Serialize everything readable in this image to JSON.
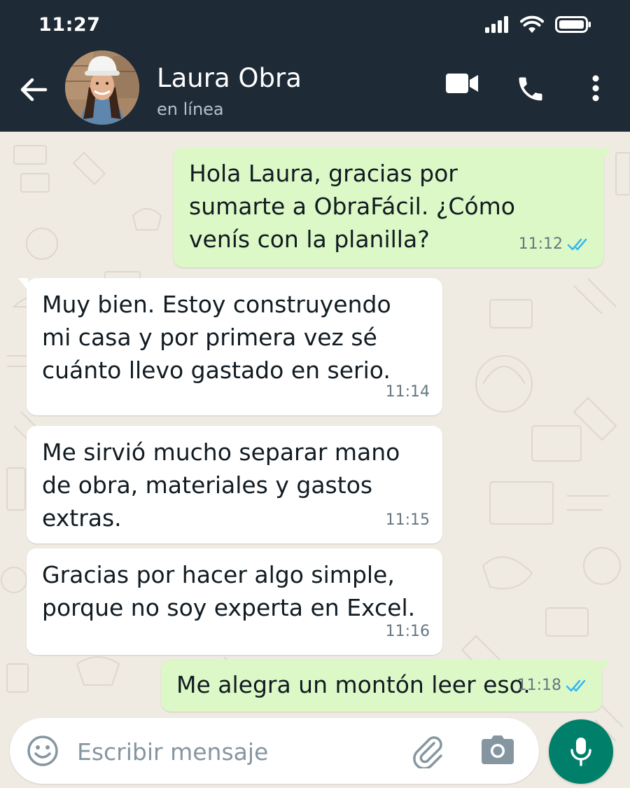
{
  "status_bar": {
    "time": "11:27"
  },
  "contact": {
    "name": "Laura Obra",
    "status": "en línea"
  },
  "icons": {
    "back": "arrow-left-icon",
    "video": "video-camera-icon",
    "call": "phone-icon",
    "menu": "more-vertical-icon",
    "emoji": "emoji-icon",
    "attach": "paperclip-icon",
    "camera": "camera-icon",
    "mic": "microphone-icon"
  },
  "messages": [
    {
      "direction": "out",
      "text": "Hola Laura, gracias por\nsumarte a ObraFácil. ¿Cómo\nvenís con la planilla?",
      "time": "11:12",
      "read": true
    },
    {
      "direction": "in",
      "text": "Muy bien. Estoy construyendo\nmi casa y por primera vez sé\ncuánto llevo gastado en serio.",
      "time": "11:14"
    },
    {
      "direction": "in",
      "text": "Me sirvió mucho separar mano\nde obra, materiales y gastos\nextras.",
      "time": "11:15"
    },
    {
      "direction": "in",
      "text": "Gracias por hacer algo simple,\nporque no soy experta en Excel.",
      "time": "11:16"
    },
    {
      "direction": "out",
      "text": "Me alegra un montón leer eso.",
      "time": "11:18",
      "read": true
    }
  ],
  "composer": {
    "placeholder": "Escribir mensaje",
    "value": ""
  },
  "colors": {
    "header": "#1e2a35",
    "outgoing_bubble": "#dcf8c6",
    "incoming_bubble": "#ffffff",
    "chat_background": "#efeae2",
    "read_ticks": "#34b7f1",
    "mic_button": "#00806a"
  }
}
